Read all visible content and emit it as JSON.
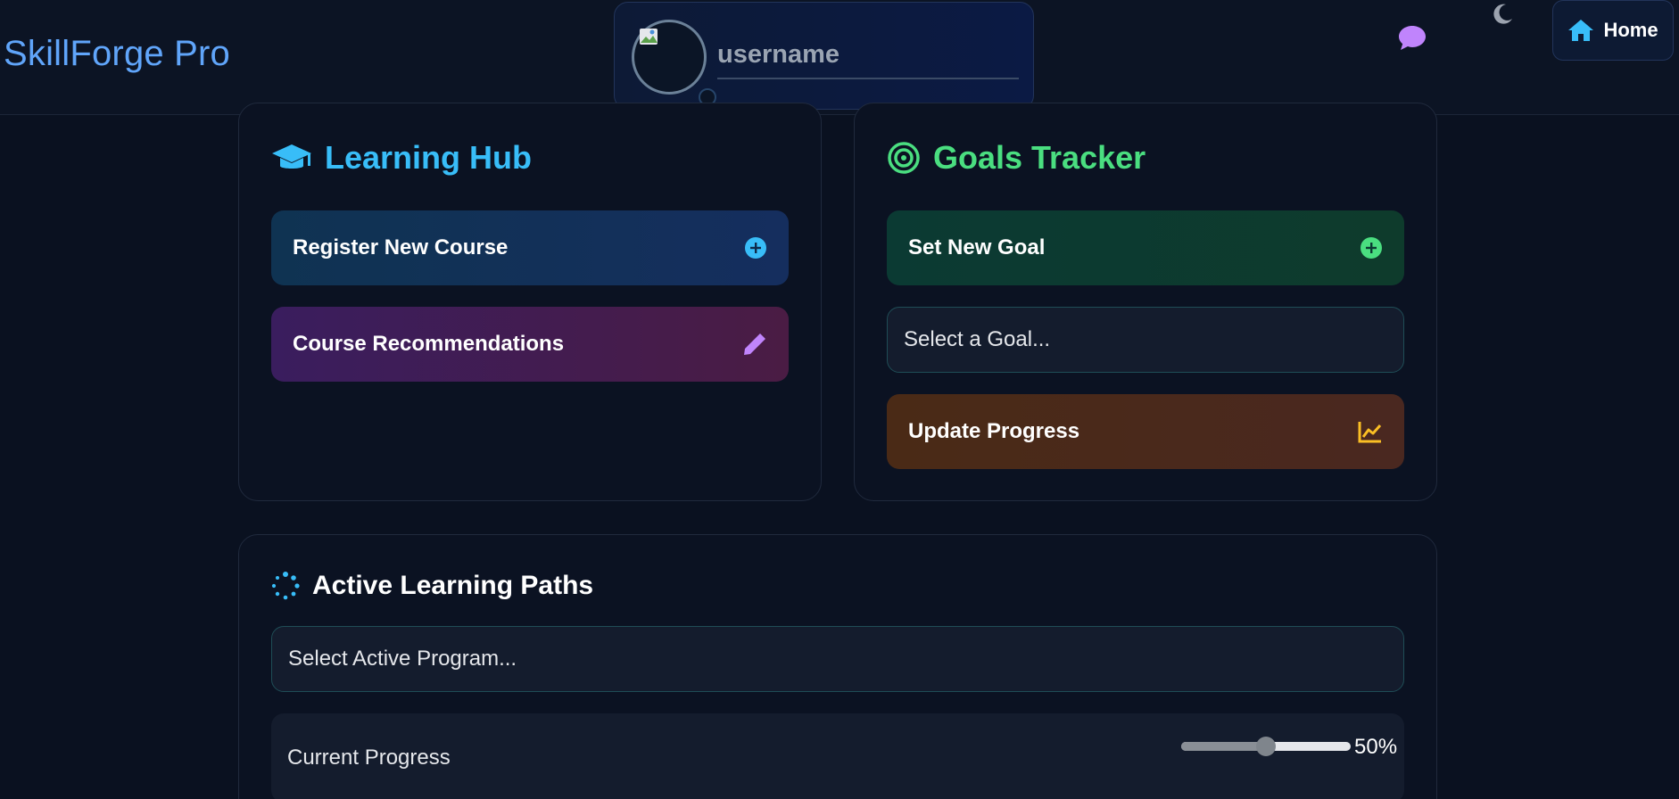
{
  "header": {
    "brand": "SkillForge Pro",
    "username_placeholder": "username",
    "home_label": "Home"
  },
  "learning_hub": {
    "title": "Learning Hub",
    "register_label": "Register New Course",
    "recommendations_label": "Course Recommendations"
  },
  "goals_tracker": {
    "title": "Goals Tracker",
    "set_goal_label": "Set New Goal",
    "select_goal_placeholder": "Select a Goal...",
    "update_progress_label": "Update Progress"
  },
  "active_paths": {
    "title": "Active Learning Paths",
    "select_program_placeholder": "Select Active Program...",
    "progress_label": "Current Progress",
    "progress_value_text": "50%",
    "progress_fraction": 0.5
  },
  "colors": {
    "brand": "#60a5fa",
    "learning_hub_title": "#38bdf8",
    "goals_title": "#4ade80",
    "chat_icon": "#c084fc",
    "plus_blue": "#38bdf8",
    "plus_green": "#4ade80",
    "pencil": "#c084fc",
    "chart": "#fbbf24"
  },
  "icons": {
    "chat": "chat-bubble-icon",
    "theme": "moon-icon",
    "home": "home-icon",
    "learning_hub": "graduation-cap-icon",
    "goals": "target-icon",
    "register": "plus-circle-icon",
    "recommendations": "pencil-icon",
    "set_goal": "plus-circle-icon",
    "update_progress": "chart-line-icon",
    "active_paths": "spinner-icon"
  }
}
